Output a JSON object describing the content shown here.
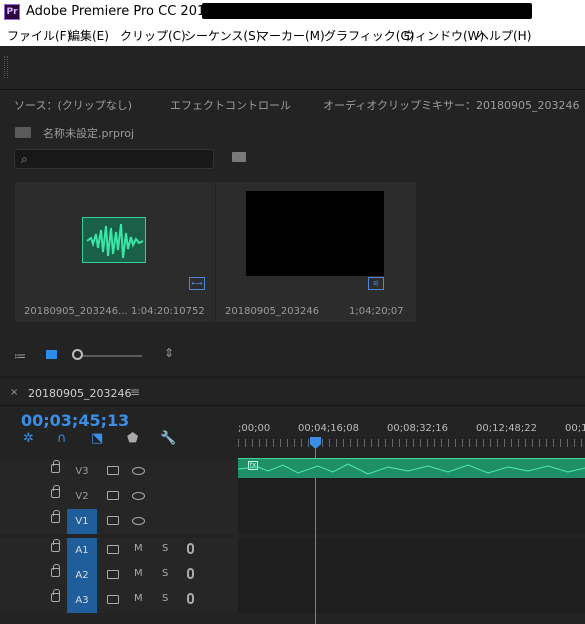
{
  "window": {
    "title": "Adobe Premiere Pro CC 2017 -",
    "app_icon": "Pr"
  },
  "menu": [
    "ファイル(F)",
    "編集(E)",
    "クリップ(C)",
    "シーケンス(S)",
    "マーカー(M)",
    "グラフィック(G)",
    "ウィンドウ(W)",
    "ヘルプ(H)"
  ],
  "project_panel": {
    "tabs": [
      "ソース：(クリップなし)",
      "エフェクトコントロール",
      "オーディオクリップミキサー：20180905_203246"
    ],
    "project_name": "名称未設定.prproj",
    "search_placeholder": "",
    "items": [
      {
        "name": "20180905_203246...",
        "duration": "1:04:20:10752",
        "type": "audio"
      },
      {
        "name": "20180905_203246",
        "duration": "1;04;20;07",
        "type": "sequence"
      }
    ]
  },
  "sequence": {
    "tab_name": "20180905_203246",
    "close": "×",
    "menu_icon": "≡",
    "timecode": "00;03;45;13",
    "ruler": [
      ";00;00",
      "00;04;16;08",
      "00;08;32;16",
      "00;12;48;22",
      "00;1"
    ],
    "tracks": [
      {
        "label": "V3",
        "kind": "video",
        "active": false
      },
      {
        "label": "V2",
        "kind": "video",
        "active": false
      },
      {
        "label": "V1",
        "kind": "video",
        "active": true
      },
      {
        "label": "A1",
        "kind": "audio",
        "active": true,
        "m": "M",
        "s": "S"
      },
      {
        "label": "A2",
        "kind": "audio",
        "active": true,
        "m": "M",
        "s": "S"
      },
      {
        "label": "A3",
        "kind": "audio",
        "active": true,
        "m": "M",
        "s": "S"
      }
    ]
  },
  "colors": {
    "accent": "#3a8ee6",
    "audio_clip": "#1e8f66",
    "track_active": "#1f5d9b"
  }
}
